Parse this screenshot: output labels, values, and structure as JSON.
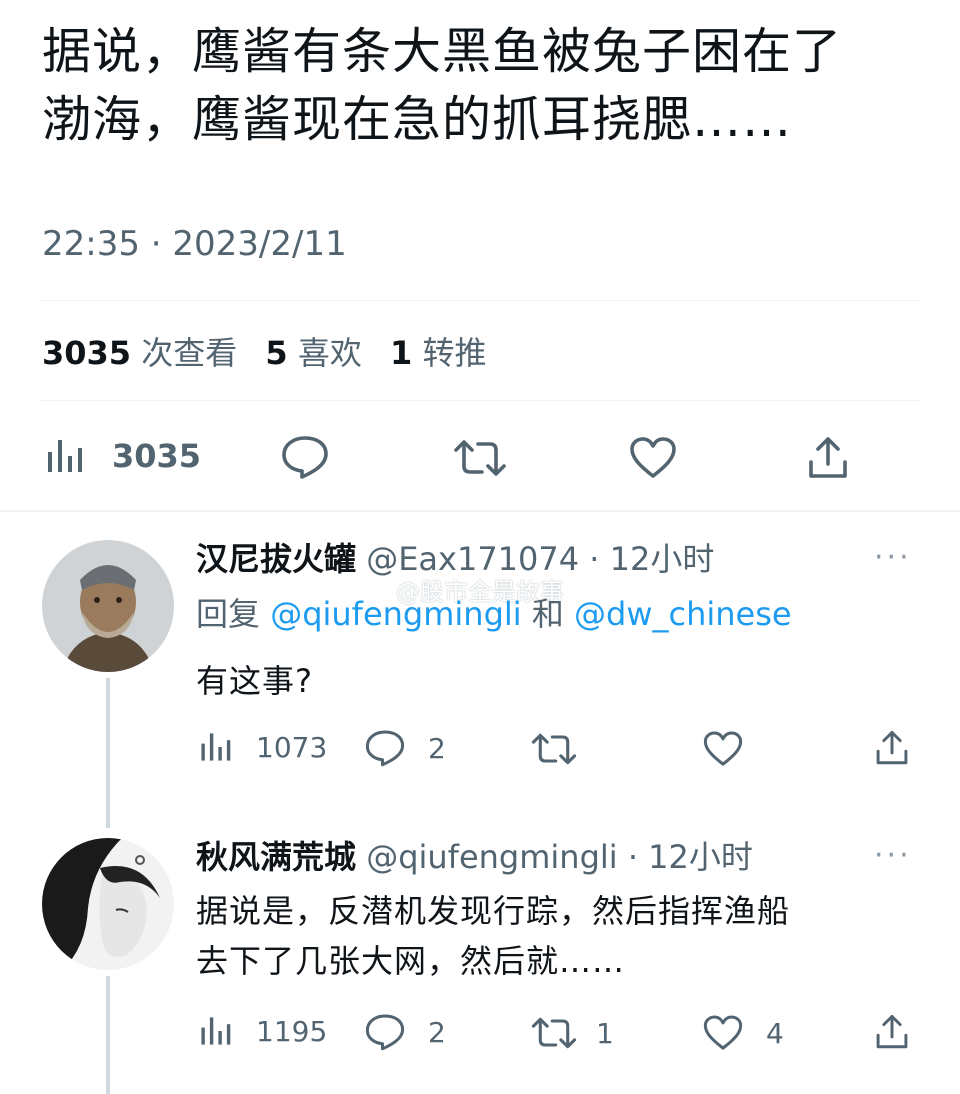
{
  "tweet": {
    "text_line1": "据说，鹰酱有条大黑鱼被兔子困在了",
    "text_line2": "渤海，鹰酱现在急的抓耳挠腮……",
    "time": "22:35 · 2023/2/11",
    "stats": {
      "views_count": "3035",
      "views_label": "次查看",
      "likes_count": "5",
      "likes_label": "喜欢",
      "retweets_count": "1",
      "retweets_label": "转推"
    },
    "actions": {
      "views": "3035"
    }
  },
  "watermark": "@股市全是故事",
  "replies": [
    {
      "name": "汉尼拔火罐",
      "handle": "@Eax171074",
      "time": "· 12小时",
      "reply_prefix": "回复",
      "mention1": "@qiufengmingli",
      "conj": "和",
      "mention2": "@dw_chinese",
      "body": "有这事?",
      "views": "1073",
      "comments": "2",
      "retweets": "",
      "likes": ""
    },
    {
      "name": "秋风满荒城",
      "handle": "@qiufengmingli",
      "time": "· 12小时",
      "body_line1": "据说是，反潜机发现行踪，然后指挥渔船",
      "body_line2": "去下了几张大网，然后就……",
      "views": "1195",
      "comments": "2",
      "retweets": "1",
      "likes": "4"
    }
  ],
  "more_icon": "···",
  "icons": [
    "views-icon",
    "reply-icon",
    "retweet-icon",
    "like-icon",
    "share-icon",
    "more-icon"
  ],
  "colors": {
    "text": "#0f1419",
    "muted": "#536471",
    "link": "#1d9bf0",
    "divider": "#eff3f4"
  }
}
